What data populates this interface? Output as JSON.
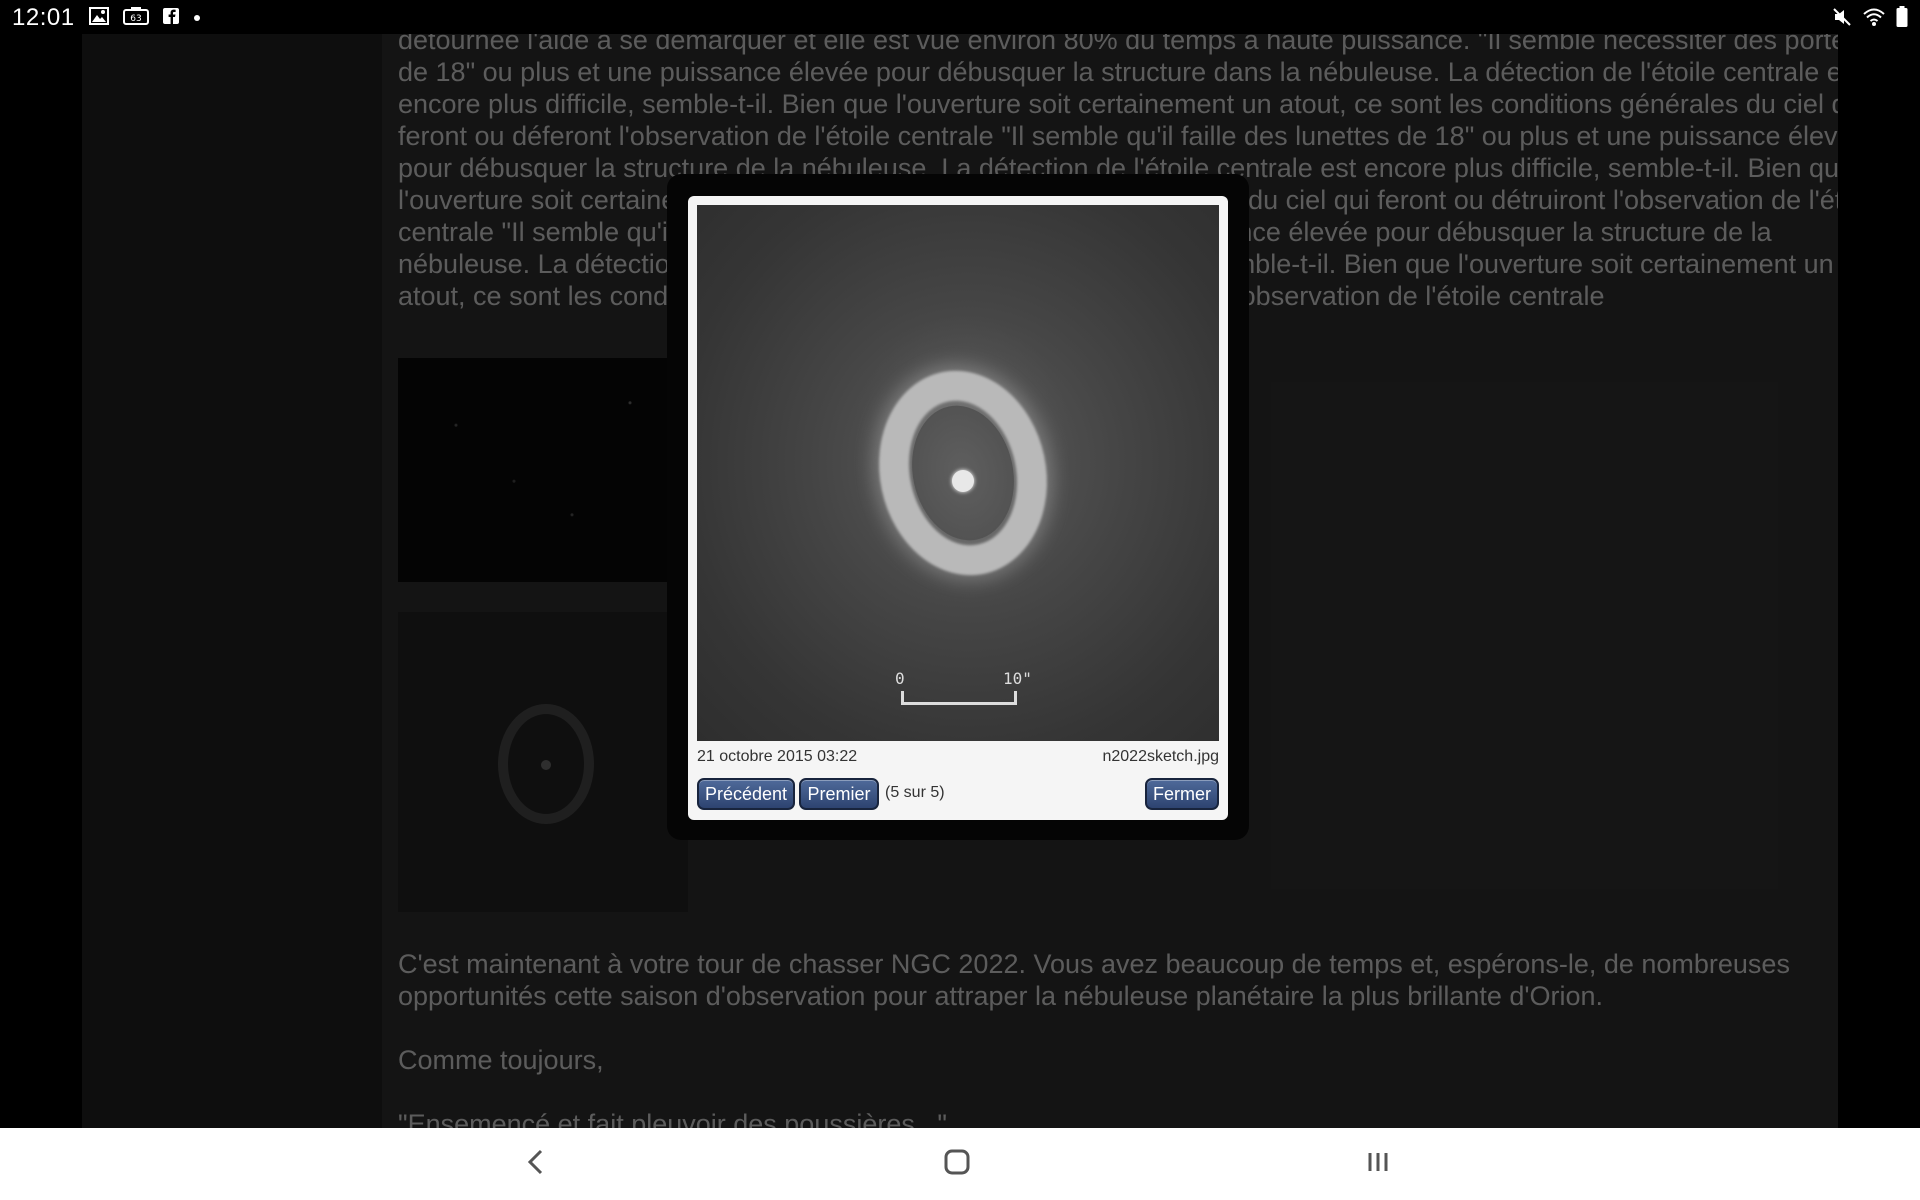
{
  "status_bar": {
    "time": "12:01",
    "left_icons": [
      "image-icon",
      "hdr-camera-icon",
      "facebook-icon",
      "dot-icon"
    ],
    "right_icons": [
      "mute-icon",
      "wifi-icon",
      "battery-icon"
    ]
  },
  "article": {
    "paragraph1": "détournée l'aide à se démarquer et elle est vue environ 80% du temps à haute puissance. \"Il semble nécessiter des portées de 18\" ou plus et une puissance élevée pour débusquer la structure dans la nébuleuse. La détection de l'étoile centrale est encore plus difficile, semble-t-il. Bien que l'ouverture soit certainement un atout, ce sont les conditions générales du ciel qui feront ou déferont l'observation de l'étoile centrale \"Il semble qu'il faille des lunettes de 18\" ou plus et une puissance élevée pour débusquer la structure de la nébuleuse. La détection de l'étoile centrale est encore plus difficile, semble-t-il. Bien que l'ouverture soit certainement un atout, ce sont les conditions générales du ciel qui feront ou détruiront l'observation de l'étoile centrale \"Il semble qu'il faille des lunettes de 18\" ou plus et une puissance élevée pour débusquer la structure de la nébuleuse. La détection de l'étoile centrale est encore plus difficile, semble-t-il. Bien que l'ouverture soit certainement un atout, ce sont les conditions générales du ciel qui feront ou détruiront l'observation de l'étoile centrale",
    "paragraph2": "C'est maintenant à votre tour de chasser NGC 2022. Vous avez beaucoup de temps et, espérons-le, de nombreuses opportunités cette saison d'observation pour attraper la nébuleuse planétaire la plus brillante d'Orion.",
    "paragraph3": "Comme toujours,",
    "paragraph4": "\"Ensemencé et fait pleuvoir des poussières...\""
  },
  "lightbox": {
    "image_alt": "n2022sketch.jpg",
    "scale_label_start": "0",
    "scale_label_end": "10\"",
    "date": "21 octobre 2015 03:22",
    "filename": "n2022sketch.jpg",
    "prev_label": "Précédent",
    "first_label": "Premier",
    "counter": "(5 sur 5)",
    "close_label": "Fermer"
  },
  "nav_bar": {
    "icons": [
      "back-icon",
      "home-icon",
      "recents-icon"
    ]
  },
  "colors": {
    "button_gradient_top": "#4f6a9a",
    "button_gradient_bottom": "#2d4370",
    "lightbox_bg": "#f5f5f5",
    "page_bg": "#262626"
  }
}
